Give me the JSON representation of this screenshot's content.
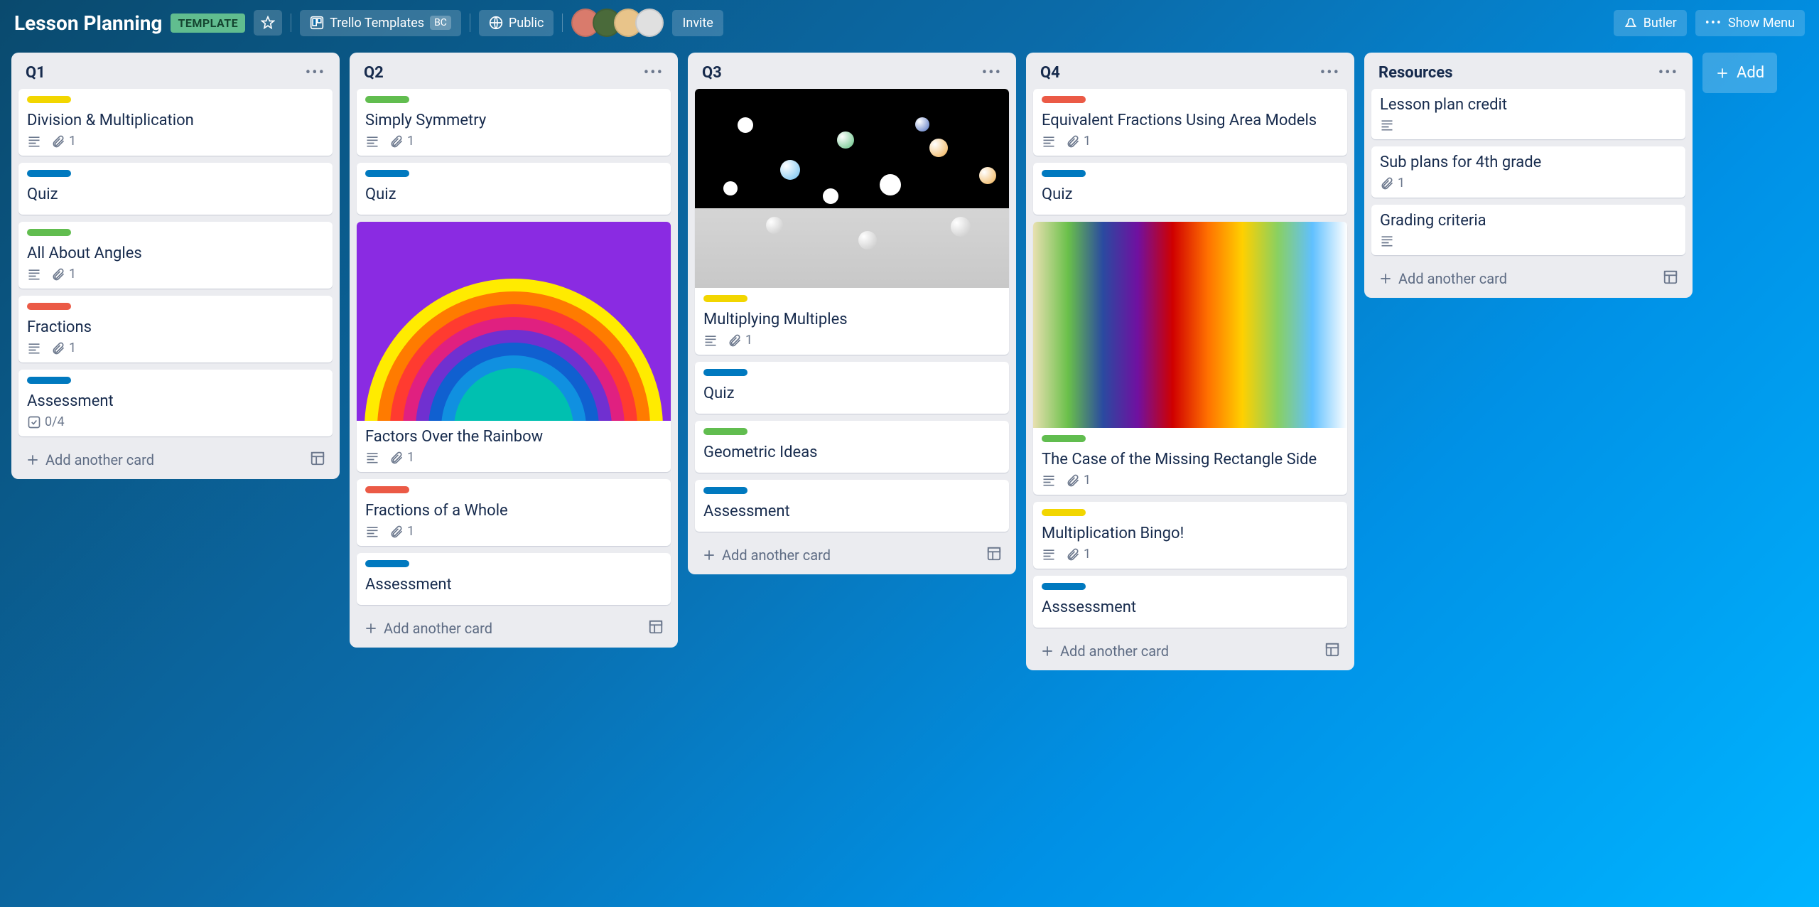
{
  "header": {
    "title": "Lesson Planning",
    "template_badge": "TEMPLATE",
    "workspace": "Trello Templates",
    "workspace_badge": "BC",
    "visibility": "Public",
    "invite": "Invite",
    "butler": "Butler",
    "show_menu": "Show Menu"
  },
  "add_list_label": "Add",
  "add_card_label": "Add another card",
  "lists": [
    {
      "title": "Q1",
      "cards": [
        {
          "label": "yellow",
          "title": "Division & Multiplication",
          "desc": true,
          "attach": "1"
        },
        {
          "label": "blue",
          "title": "Quiz"
        },
        {
          "label": "green",
          "title": "All About Angles",
          "desc": true,
          "attach": "1"
        },
        {
          "label": "red",
          "title": "Fractions",
          "desc": true,
          "attach": "1"
        },
        {
          "label": "blue",
          "title": "Assessment",
          "checklist": "0/4"
        }
      ]
    },
    {
      "title": "Q2",
      "cards": [
        {
          "label": "green",
          "title": "Simply Symmetry",
          "desc": true,
          "attach": "1"
        },
        {
          "label": "blue",
          "title": "Quiz"
        },
        {
          "cover": "rainbow",
          "title": "Factors Over the Rainbow",
          "desc": true,
          "attach": "1"
        },
        {
          "label": "red",
          "title": "Fractions of a Whole",
          "desc": true,
          "attach": "1"
        },
        {
          "label": "blue",
          "title": "Assessment"
        }
      ]
    },
    {
      "title": "Q3",
      "cards": [
        {
          "cover": "black",
          "label": "yellow",
          "title": "Multiplying Multiples",
          "desc": true,
          "attach": "1"
        },
        {
          "label": "blue",
          "title": "Quiz"
        },
        {
          "label": "green",
          "title": "Geometric Ideas"
        },
        {
          "label": "blue",
          "title": "Assessment"
        }
      ]
    },
    {
      "title": "Q4",
      "cards": [
        {
          "label": "red",
          "title": "Equivalent Fractions Using Area Models",
          "desc": true,
          "attach": "1"
        },
        {
          "label": "blue",
          "title": "Quiz"
        },
        {
          "cover": "prism",
          "label": "green",
          "title": "The Case of the Missing Rectangle Side",
          "desc": true,
          "attach": "1"
        },
        {
          "label": "yellow",
          "title": "Multiplication Bingo!",
          "desc": true,
          "attach": "1"
        },
        {
          "label": "blue",
          "title": "Asssessment"
        }
      ]
    },
    {
      "title": "Resources",
      "cards": [
        {
          "title": "Lesson plan credit",
          "desc": true
        },
        {
          "title": "Sub plans for 4th grade",
          "attach": "1"
        },
        {
          "title": "Grading criteria",
          "desc": true
        }
      ]
    }
  ]
}
